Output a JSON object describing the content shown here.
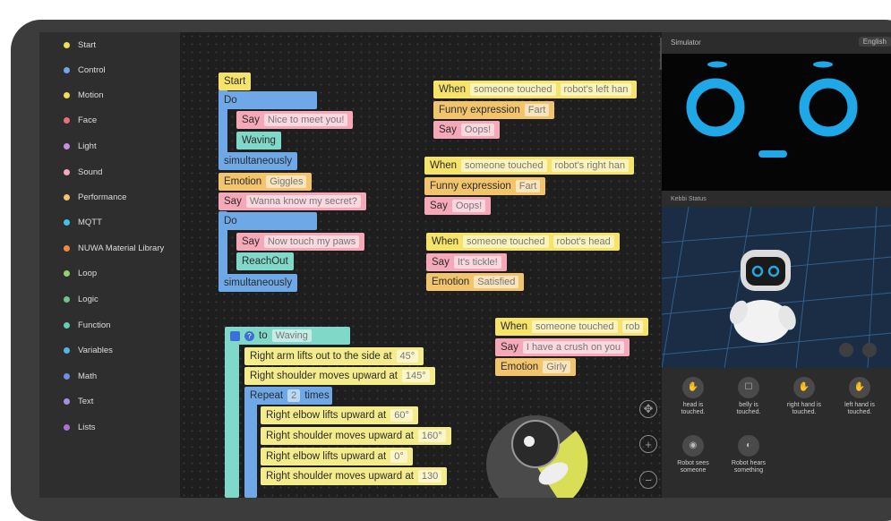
{
  "sidebar": {
    "categories": [
      {
        "label": "Start",
        "color": "#f2dc52"
      },
      {
        "label": "Control",
        "color": "#6fa8e6"
      },
      {
        "label": "Motion",
        "color": "#f2dc52"
      },
      {
        "label": "Face",
        "color": "#e96f7a"
      },
      {
        "label": "Light",
        "color": "#c88ee6"
      },
      {
        "label": "Sound",
        "color": "#f4a8b8"
      },
      {
        "label": "Performance",
        "color": "#f2c46b"
      },
      {
        "label": "MQTT",
        "color": "#39c6e8"
      },
      {
        "label": "NUWA Material Library",
        "color": "#f08a3c"
      },
      {
        "label": "Loop",
        "color": "#8fd36a"
      },
      {
        "label": "Logic",
        "color": "#6fc48a"
      },
      {
        "label": "Function",
        "color": "#5fd0b8"
      },
      {
        "label": "Variables",
        "color": "#4fb8e0"
      },
      {
        "label": "Math",
        "color": "#6f8fe6"
      },
      {
        "label": "Text",
        "color": "#a98ee6"
      },
      {
        "label": "Lists",
        "color": "#b06fd6"
      }
    ]
  },
  "workspace": {
    "main_script": {
      "start": "Start",
      "do1": "Do",
      "say1_label": "Say",
      "say1_value": "Nice to meet you!",
      "waving": "Waving",
      "simul1": "simultaneously",
      "emotion_label": "Emotion",
      "emotion_value": "Giggles",
      "say2_label": "Say",
      "say2_value": "Wanna know my secret?",
      "do2": "Do",
      "say3_label": "Say",
      "say3_value": "Now touch my paws",
      "reachout": "ReachOut",
      "simul2": "simultaneously"
    },
    "function_block": {
      "to": "to",
      "name": "Waving",
      "line1_text": "Right arm lifts out to the side at",
      "line1_value": "45°",
      "line2_text": "Right shoulder moves upward at",
      "line2_value": "145°",
      "repeat_label": "Repeat",
      "repeat_value": "2",
      "repeat_times": "times",
      "r1_text": "Right elbow lifts upward at",
      "r1_value": "60°",
      "r2_text": "Right shoulder moves upward at",
      "r2_value": "160°",
      "r3_text": "Right elbow lifts upward at",
      "r3_value": "0°",
      "r4_text": "Right shoulder moves upward at",
      "r4_value": "130"
    },
    "events": [
      {
        "when": "When",
        "trigger": "someone touched",
        "target": "robot's left han",
        "line2_label": "Funny expression",
        "line2_value": "Fart",
        "line3_label": "Say",
        "line3_value": "Oops!"
      },
      {
        "when": "When",
        "trigger": "someone touched",
        "target": "robot's right han",
        "line2_label": "Funny expression",
        "line2_value": "Fart",
        "line3_label": "Say",
        "line3_value": "Oops!"
      },
      {
        "when": "When",
        "trigger": "someone touched",
        "target": "robot's head",
        "line2_label": "Say",
        "line2_value": "It's tickle!",
        "line3_label": "Emotion",
        "line3_value": "Satisfied"
      },
      {
        "when": "When",
        "trigger": "someone touched",
        "target": "rob",
        "line2_label": "Say",
        "line2_value": "I have a crush on you",
        "line3_label": "Emotion",
        "line3_value": "Girly"
      }
    ],
    "collapse_arrow": "›"
  },
  "simulator": {
    "title": "Simulator",
    "language": "English",
    "status_label": "Kebbi Status",
    "actions": [
      {
        "label": "head is touched.",
        "icon": "head-touch-icon"
      },
      {
        "label": "belly is touched.",
        "icon": "belly-touch-icon"
      },
      {
        "label": "right hand is touched.",
        "icon": "right-hand-touch-icon"
      },
      {
        "label": "left hand is touched.",
        "icon": "left-hand-touch-icon"
      },
      {
        "label": "Robot sees someone",
        "icon": "robot-sees-icon"
      },
      {
        "label": "Robot hears something",
        "icon": "robot-hears-icon"
      }
    ]
  },
  "colors": {
    "face_ring": "#1fa8e8",
    "accent_yellow": "#f2dc52"
  }
}
